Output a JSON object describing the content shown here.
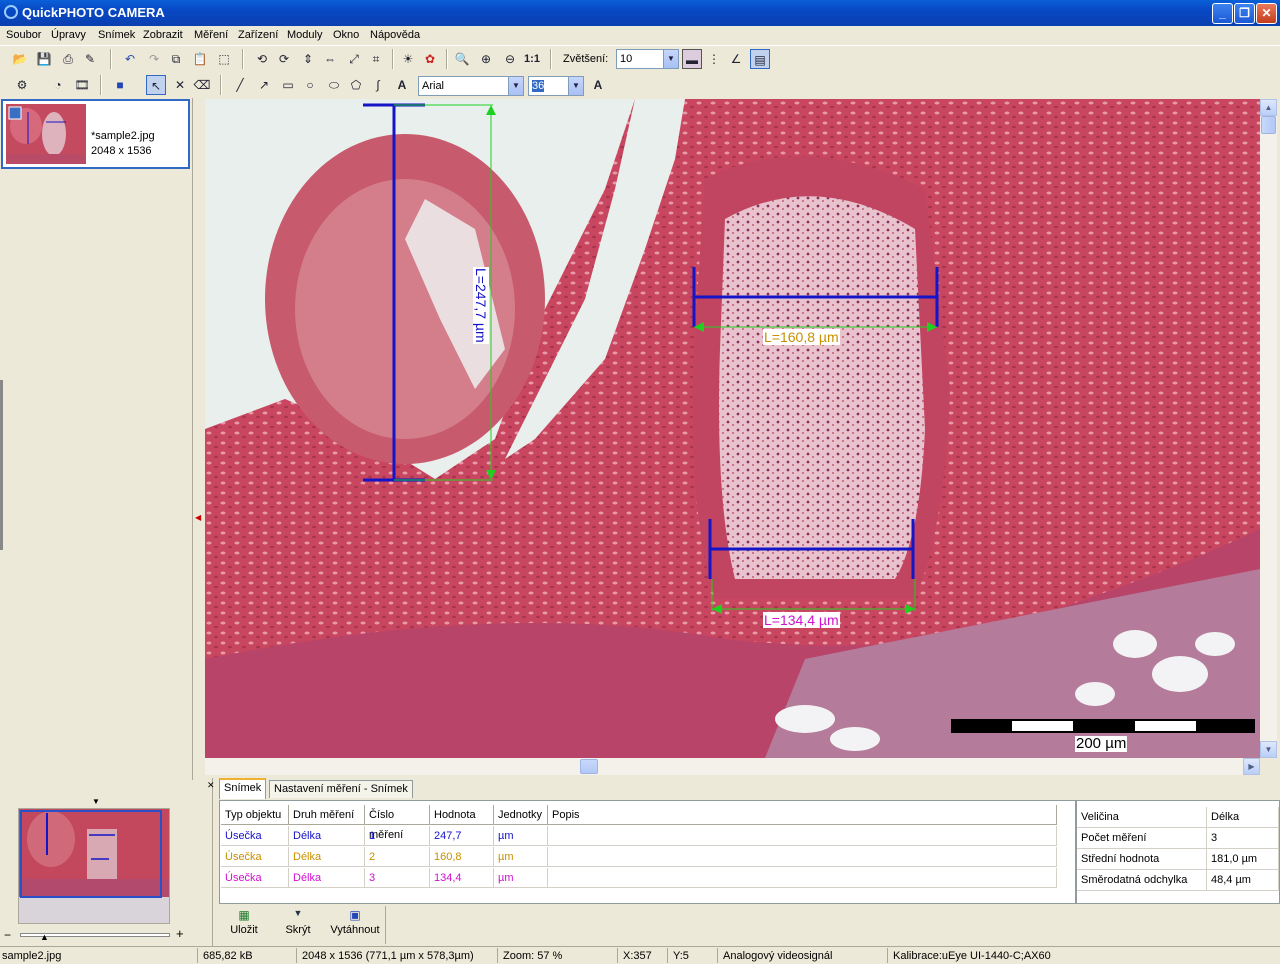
{
  "window": {
    "title": "QuickPHOTO CAMERA"
  },
  "menu": [
    "Soubor",
    "Úpravy",
    "Snímek",
    "Zobrazit",
    "Měření",
    "Zařízení",
    "Moduly",
    "Okno",
    "Nápověda"
  ],
  "toolbar": {
    "zoom_label": "Zvětšení:",
    "zoom_value": "10",
    "font_value": "Arial",
    "font_size_value": "36",
    "one_to_one": "1:1"
  },
  "thumbnail": {
    "filename": "*sample2.jpg",
    "dimensions": "2048 x 1536"
  },
  "measurements_overlay": {
    "m1": "L=247,7 µm",
    "m2": "L=160,8 µm",
    "m3": "L=134,4 µm",
    "scalebar": "200 µm"
  },
  "tabs": [
    "Snímek",
    "Nastavení měření - Snímek"
  ],
  "table": {
    "headers": [
      "Typ objektu",
      "Druh měření",
      "Číslo měření",
      "Hodnota",
      "Jednotky",
      "Popis"
    ],
    "rows": [
      {
        "type": "Úsečka",
        "kind": "Délka",
        "num": "1",
        "value": "247,7",
        "unit": "µm",
        "desc": "",
        "color": "#1414c8"
      },
      {
        "type": "Úsečka",
        "kind": "Délka",
        "num": "2",
        "value": "160,8",
        "unit": "µm",
        "desc": "",
        "color": "#c89000"
      },
      {
        "type": "Úsečka",
        "kind": "Délka",
        "num": "3",
        "value": "134,4",
        "unit": "µm",
        "desc": "",
        "color": "#d010d0"
      }
    ]
  },
  "stats": {
    "header": [
      "Veličina",
      "Délka"
    ],
    "rows": [
      [
        "Počet měření",
        "3"
      ],
      [
        "Střední hodnota",
        "181,0 µm"
      ],
      [
        "Směrodatná odchylka",
        "48,4 µm"
      ]
    ]
  },
  "actions": {
    "save": "Uložit",
    "hide": "Skrýt",
    "pull": "Vytáhnout"
  },
  "statusbar": {
    "file": "sample2.jpg",
    "size": "685,82 kB",
    "dims": "2048 x 1536 (771,1 µm x 578,3µm)",
    "zoom": "Zoom: 57 %",
    "x": "X:357",
    "y": "Y:5",
    "source": "Analogový videosignál",
    "calib": "Kalibrace:uEye UI-1440-C;AX60"
  },
  "colors": {
    "title_blue": "#0a5fd8",
    "measure_blue": "#1414c8",
    "measure_green": "#20d020",
    "tissue": "#c0455b"
  }
}
